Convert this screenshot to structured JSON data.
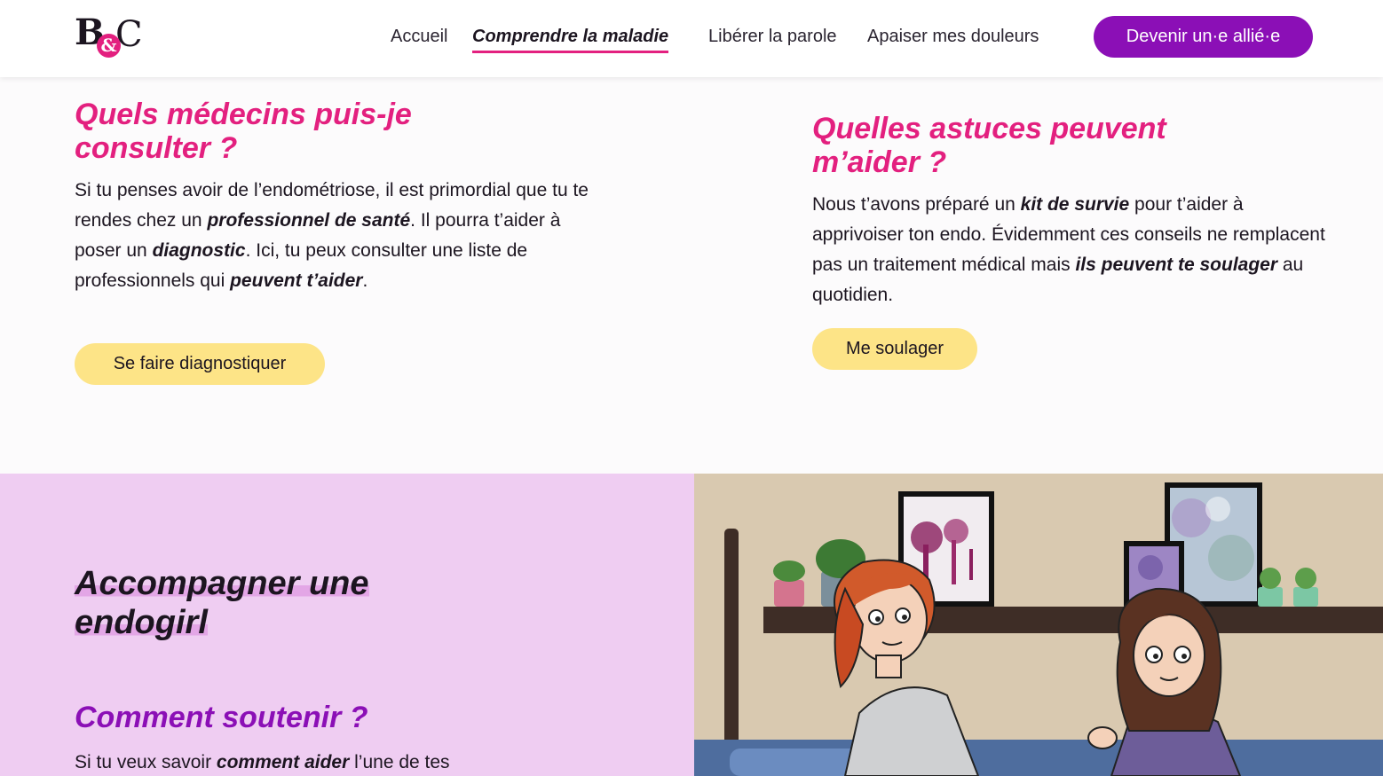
{
  "header": {
    "logo": {
      "b": "B",
      "amp": "&",
      "c": "C"
    },
    "nav": {
      "accueil": "Accueil",
      "comprendre": "Comprendre la maladie",
      "liberer": "Libérer la parole",
      "apaiser": "Apaiser mes douleurs"
    },
    "cta_label": "Devenir un·e allié·e"
  },
  "left_card": {
    "title": "Quels médecins puis-je consulter ?",
    "text_1": "Si tu penses avoir de l’endométriose, il est primordial que tu te rendes chez un ",
    "bold_1": "professionnel de santé",
    "text_2": ". Il pourra t’aider à poser un ",
    "bold_2": "diagnostic",
    "text_3": ". Ici, tu peux consulter une liste de professionnels qui ",
    "bold_3": "peuvent t’aider",
    "text_4": ".",
    "button": "Se faire diagnostiquer"
  },
  "right_card": {
    "title": "Quelles astuces peuvent m’aider ?",
    "text_1": "Nous t’avons préparé un ",
    "bold_1": "kit de survie",
    "text_2": " pour t’aider à apprivoiser ton endo. Évidemment ces conseils ne remplacent pas un traitement médical mais ",
    "bold_2": "ils peuvent te soulager",
    "text_3": " au quotidien.",
    "button": "Me soulager"
  },
  "bottom": {
    "title_line1": "Accompagner une",
    "title_line2": "endogirl",
    "subtitle": "Comment soutenir ?",
    "text_1": "Si tu veux savoir ",
    "bold_1": "comment aider",
    "text_2": " l’une de tes"
  },
  "colors": {
    "pink": "#e3207f",
    "purple": "#8b0fb6",
    "yellow": "#fde487",
    "lilac": "#efcdf2"
  }
}
